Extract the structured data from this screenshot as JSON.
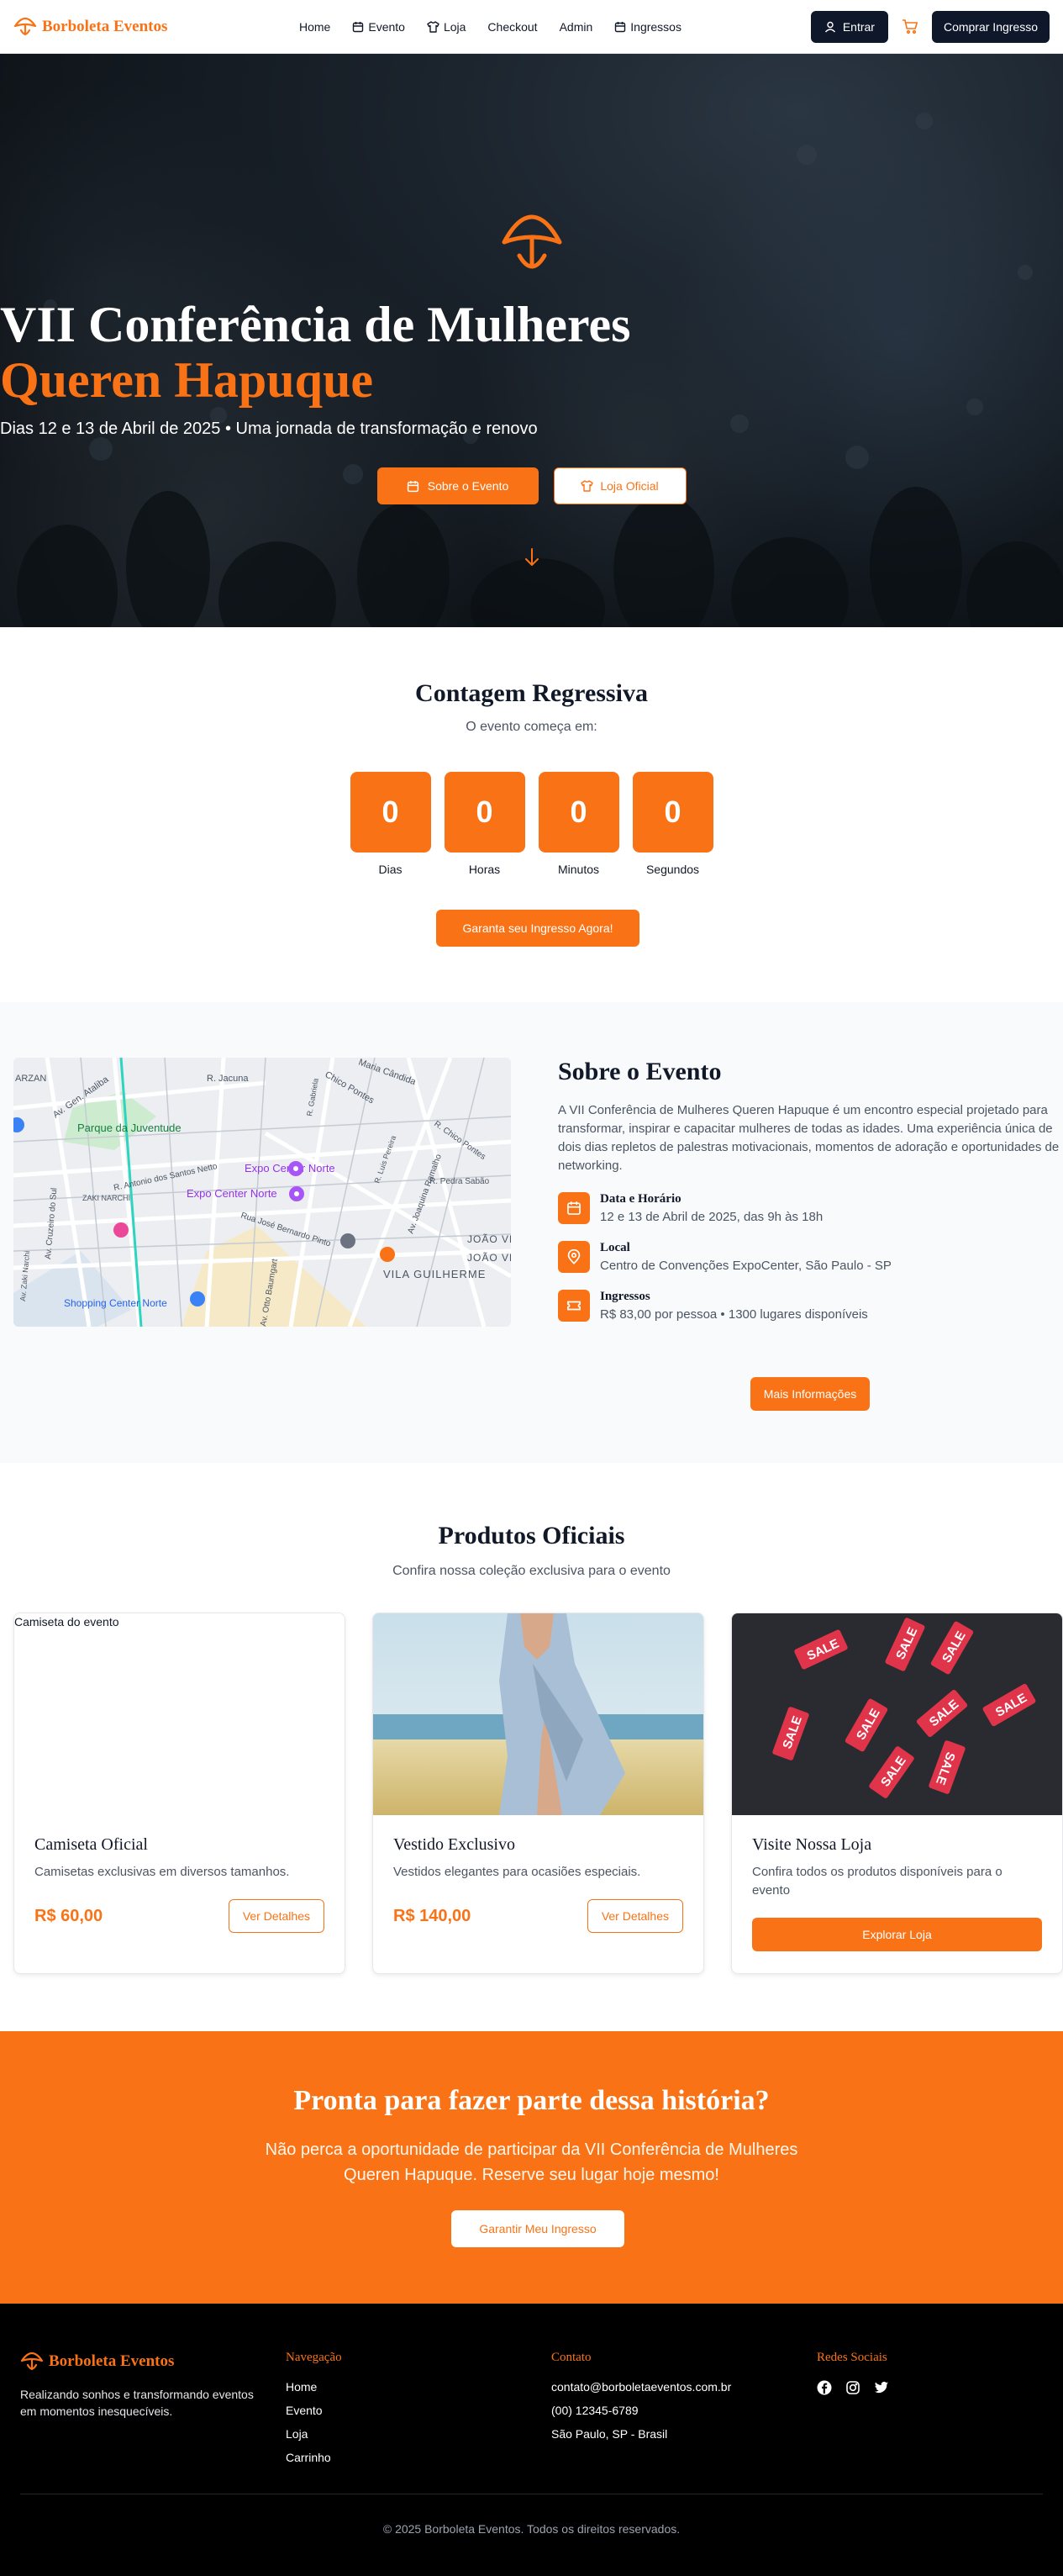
{
  "brand": {
    "name": "Borboleta Eventos",
    "color": "#f97316"
  },
  "nav": {
    "items": [
      {
        "label": "Home",
        "icon": ""
      },
      {
        "label": "Evento",
        "icon": "calendar-icon"
      },
      {
        "label": "Loja",
        "icon": "shirt-icon"
      },
      {
        "label": "Checkout",
        "icon": ""
      },
      {
        "label": "Admin",
        "icon": ""
      },
      {
        "label": "Ingressos",
        "icon": "calendar-icon"
      }
    ],
    "login_label": "Entrar",
    "buy_label": "Comprar Ingresso"
  },
  "hero": {
    "title": "VII Conferência de Mulheres",
    "subtitle": "Queren Hapuque",
    "date_line": "Dias 12 e 13 de Abril de 2025 • Uma jornada de transformação e renovo",
    "btn_about": "Sobre o Evento",
    "btn_store": "Loja Oficial"
  },
  "countdown": {
    "title": "Contagem Regressiva",
    "subtitle": "O evento começa em:",
    "units": [
      {
        "value": "0",
        "label": "Dias"
      },
      {
        "value": "0",
        "label": "Horas"
      },
      {
        "value": "0",
        "label": "Minutos"
      },
      {
        "value": "0",
        "label": "Segundos"
      }
    ],
    "cta": "Garanta seu Ingresso Agora!"
  },
  "map": {
    "labels": [
      "ARZAN",
      "Av. Gen. Ataliba",
      "R. Jacuna",
      "Chico Pontes",
      "Maria Cândida",
      "Parque da Juventude",
      "R. Antonio dos Santos Netto",
      "Expo Center Norte",
      "Expo Center Norte",
      "ZAKI NARCHI",
      "Rua José Bernardo Pinto",
      "Av. Joaquina Ramalho",
      "R. Pedra Sabão",
      "JOÃO VELOSO",
      "JOÃO VELOSO",
      "VILA GUILHERME",
      "Shopping Center Norte",
      "Av. Cruzeiro do Sul",
      "Av. Otto Baumgart",
      "Av. Zaki Narchi",
      "R. Chico Pontes",
      "R. Gabriela",
      "R. Luis Pereira"
    ]
  },
  "about": {
    "title": "Sobre o Evento",
    "description": "A VII Conferência de Mulheres Queren Hapuque é um encontro especial projetado para transformar, inspirar e capacitar mulheres de todas as idades. Uma experiência única de dois dias repletos de palestras motivacionais, momentos de adoração e oportunidades de networking.",
    "details": [
      {
        "title": "Data e Horário",
        "value": "12 e 13 de Abril de 2025, das 9h às 18h",
        "icon": "calendar-icon"
      },
      {
        "title": "Local",
        "value": "Centro de Convenções ExpoCenter, São Paulo - SP",
        "icon": "location-pin-icon"
      },
      {
        "title": "Ingressos",
        "value": "R$ 83,00 por pessoa • 1300 lugares disponíveis",
        "icon": "ticket-icon"
      }
    ],
    "more_btn": "Mais Informações"
  },
  "products": {
    "title": "Produtos Oficiais",
    "subtitle": "Confira nossa coleção exclusiva para o evento",
    "items": [
      {
        "img_alt": "Camiseta do evento",
        "title": "Camiseta Oficial",
        "desc": "Camisetas exclusivas em diversos tamanhos.",
        "price": "R$ 60,00",
        "btn": "Ver Detalhes"
      },
      {
        "img_alt": "",
        "title": "Vestido Exclusivo",
        "desc": "Vestidos elegantes para ocasiões especiais.",
        "price": "R$ 140,00",
        "btn": "Ver Detalhes"
      },
      {
        "img_alt": "",
        "title": "Visite Nossa Loja",
        "desc": "Confira todos os produtos disponíveis para o evento",
        "btn": "Explorar Loja",
        "tag": "SALE"
      }
    ]
  },
  "cta": {
    "title": "Pronta para fazer parte dessa história?",
    "text_line1": "Não perca a oportunidade de participar da VII Conferência de Mulheres",
    "text_line2": "Queren Hapuque. Reserve seu lugar hoje mesmo!",
    "btn": "Garantir Meu Ingresso"
  },
  "footer": {
    "brand": "Borboleta Eventos",
    "tagline_1": "Realizando sonhos e transformando eventos",
    "tagline_2": "em momentos inesquecíveis.",
    "nav_title": "Navegação",
    "nav_links": [
      "Home",
      "Evento",
      "Loja",
      "Carrinho"
    ],
    "contact_title": "Contato",
    "contact": [
      "contato@borboletaeventos.com.br",
      "(00) 12345-6789",
      "São Paulo, SP - Brasil"
    ],
    "social_title": "Redes Sociais",
    "social_icons": [
      "facebook-icon",
      "instagram-icon",
      "twitter-icon"
    ],
    "copyright": "© 2025 Borboleta Eventos. Todos os direitos reservados."
  }
}
